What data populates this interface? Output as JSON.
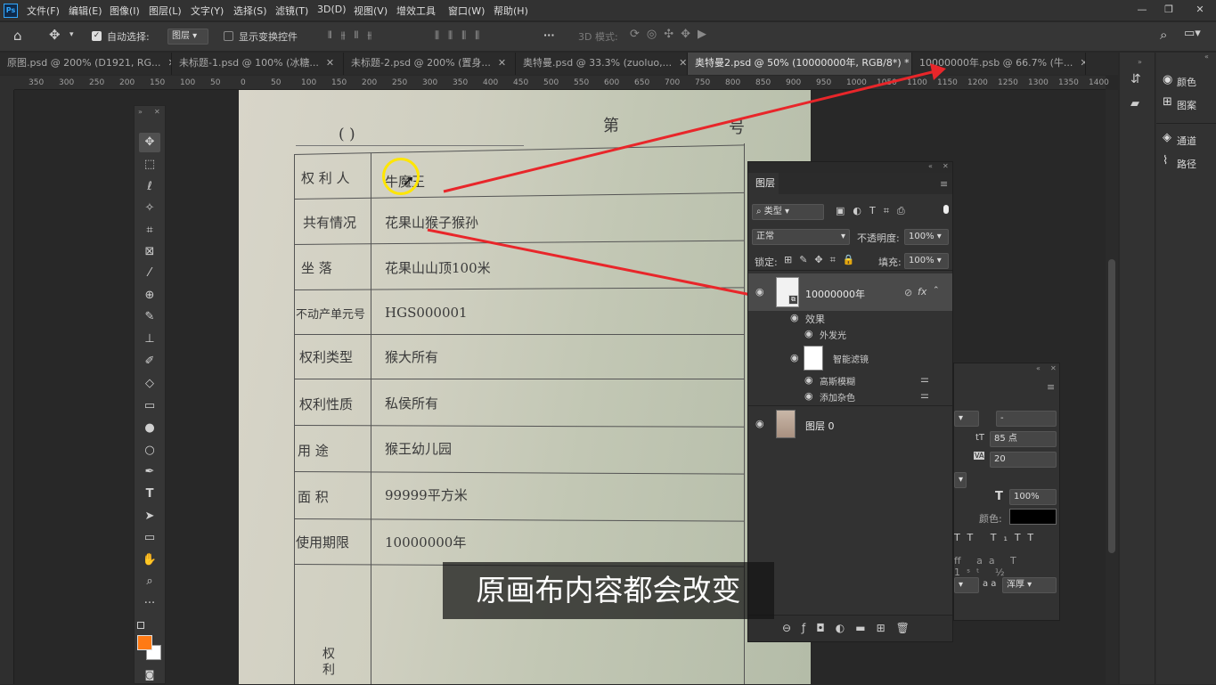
{
  "app": {
    "logo": "Ps"
  },
  "menu": [
    "文件(F)",
    "编辑(E)",
    "图像(I)",
    "图层(L)",
    "文字(Y)",
    "选择(S)",
    "滤镜(T)",
    "3D(D)",
    "视图(V)",
    "增效工具",
    "窗口(W)",
    "帮助(H)"
  ],
  "options": {
    "auto_select": "自动选择:",
    "layer_select": "图层",
    "show_transform": "显示变换控件",
    "mode3d": "3D 模式:"
  },
  "tabs": [
    {
      "label": "原图.psd @ 200% (D1921, RG..."
    },
    {
      "label": "未标题-1.psd @ 100% (冰糖..."
    },
    {
      "label": "未标题-2.psd @ 200% (置身..."
    },
    {
      "label": "奥特曼.psd @ 33.3% (zuoluo,..."
    },
    {
      "label": "奥特曼2.psd @ 50% (10000000年, RGB/8*) *"
    },
    {
      "label": "10000000年.psb @ 66.7% (牛..."
    }
  ],
  "ruler_ticks": [
    "350",
    "300",
    "250",
    "200",
    "150",
    "100",
    "50",
    "0",
    "50",
    "100",
    "150",
    "200",
    "250",
    "300",
    "350",
    "400",
    "450",
    "500",
    "550",
    "600",
    "650",
    "700",
    "750",
    "800",
    "850",
    "900",
    "950",
    "1000",
    "1050",
    "1100",
    "1150",
    "1200",
    "1250",
    "1300",
    "1350",
    "1400"
  ],
  "document": {
    "header_left": "(          )",
    "header_right": "第",
    "header_right2": "号",
    "rows": [
      {
        "label": "权 利 人",
        "value": "牛魔王"
      },
      {
        "label": "共有情况",
        "value": "花果山猴子猴孙"
      },
      {
        "label": "坐      落",
        "value": "花果山山顶100米"
      },
      {
        "label": "不动产单元号",
        "value": "HGS000001"
      },
      {
        "label": "权利类型",
        "value": "猴大所有"
      },
      {
        "label": "权利性质",
        "value": "私侯所有"
      },
      {
        "label": "用      途",
        "value": "猴王幼儿园"
      },
      {
        "label": "面      积",
        "value": "99999平方米"
      },
      {
        "label": "使用期限",
        "value": "10000000年"
      }
    ],
    "footer_label": "权利"
  },
  "layers_panel": {
    "title": "图层",
    "filter": "类型",
    "blend": "正常",
    "opacity_label": "不透明度:",
    "opacity": "100%",
    "lock_label": "锁定:",
    "fill_label": "填充:",
    "fill": "100%",
    "layers": [
      {
        "name": "10000000年",
        "fx": "fx"
      },
      {
        "name": "效果"
      },
      {
        "name": "外发光"
      },
      {
        "name": "智能滤镜"
      },
      {
        "name": "高斯模糊"
      },
      {
        "name": "添加杂色"
      },
      {
        "name": "图层 0"
      }
    ]
  },
  "char_panel": {
    "font_size": "85 点",
    "leading": "20",
    "scale": "100%",
    "color_label": "颜色:",
    "dash": "-",
    "aa": "a a",
    "aa_mode": "浑厚"
  },
  "right_dock": [
    {
      "label": "颜色"
    },
    {
      "label": "图案"
    },
    {
      "label": "通道"
    },
    {
      "label": "路径"
    }
  ],
  "caption": "原画布内容都会改变",
  "colors": {
    "foreground": "#ff7a14",
    "background": "#ffffff",
    "arrow": "#e8262a",
    "highlight": "#ffe600"
  }
}
